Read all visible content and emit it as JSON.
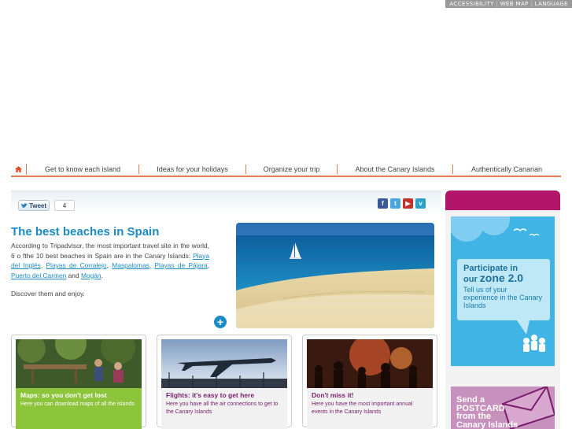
{
  "topbar": {
    "items": [
      "ACCESSIBILITY",
      "WEB MAP",
      "LANGUAGE"
    ]
  },
  "nav": {
    "home_icon": "home-icon",
    "items": [
      "Get to know each island",
      "Ideas for your holidays",
      "Organize your trip",
      "About the Canary Islands",
      "Authentically Canarian"
    ]
  },
  "share": {
    "tweet_label": "Tweet",
    "tweet_count": "4",
    "social_icons": [
      "facebook-icon",
      "twitter-icon",
      "youtube-icon",
      "vimeo-icon"
    ]
  },
  "article": {
    "title": "The best beaches in Spain",
    "intro_prefix": "According to Tripadvisor, the most important travel site in the world, 6 o fthe 10 best beaches in Spain are in the Canary Islands:",
    "beaches": [
      "Playa del Inglés",
      "Playas de Corralejo",
      "Maspalomas",
      "Playas de Pájara",
      "Puerto del Carmen",
      "Mogán"
    ],
    "and_word": "and",
    "discover": "Discover them and enjoy."
  },
  "cards": [
    {
      "title": "Maps: so you don't get lost",
      "text": "Here you can download maps of all the islands",
      "bg": "#8cc43c",
      "fg": "#ffffff"
    },
    {
      "title": "Flights: it's easy to get here",
      "text": "Here you have all the air connections to get to the Canary Islands",
      "bg": "#f1f1f1",
      "fg": "#7a1d6e"
    },
    {
      "title": "Don't miss it!",
      "text": "Here you have the most important annual events in the Canary Islands",
      "bg": "#f1f1f1",
      "fg": "#7a1d6e"
    }
  ],
  "sidebar": {
    "zone": {
      "line1": "Participate in",
      "line2_prefix": "our",
      "line2_strong": "zone 2.0",
      "body": "Tell us of your experience in the Canary Islands"
    },
    "postcard": {
      "lines": [
        "Send a",
        "POSTCARD",
        "from the",
        "Canary Islands"
      ]
    }
  },
  "colors": {
    "accent": "#1a8bc4",
    "nav_rule": "#e77a4e",
    "sidebar_head": "#b1166b",
    "zone_bg": "#3fb4e5",
    "postcard_bg": "#c691bd"
  }
}
